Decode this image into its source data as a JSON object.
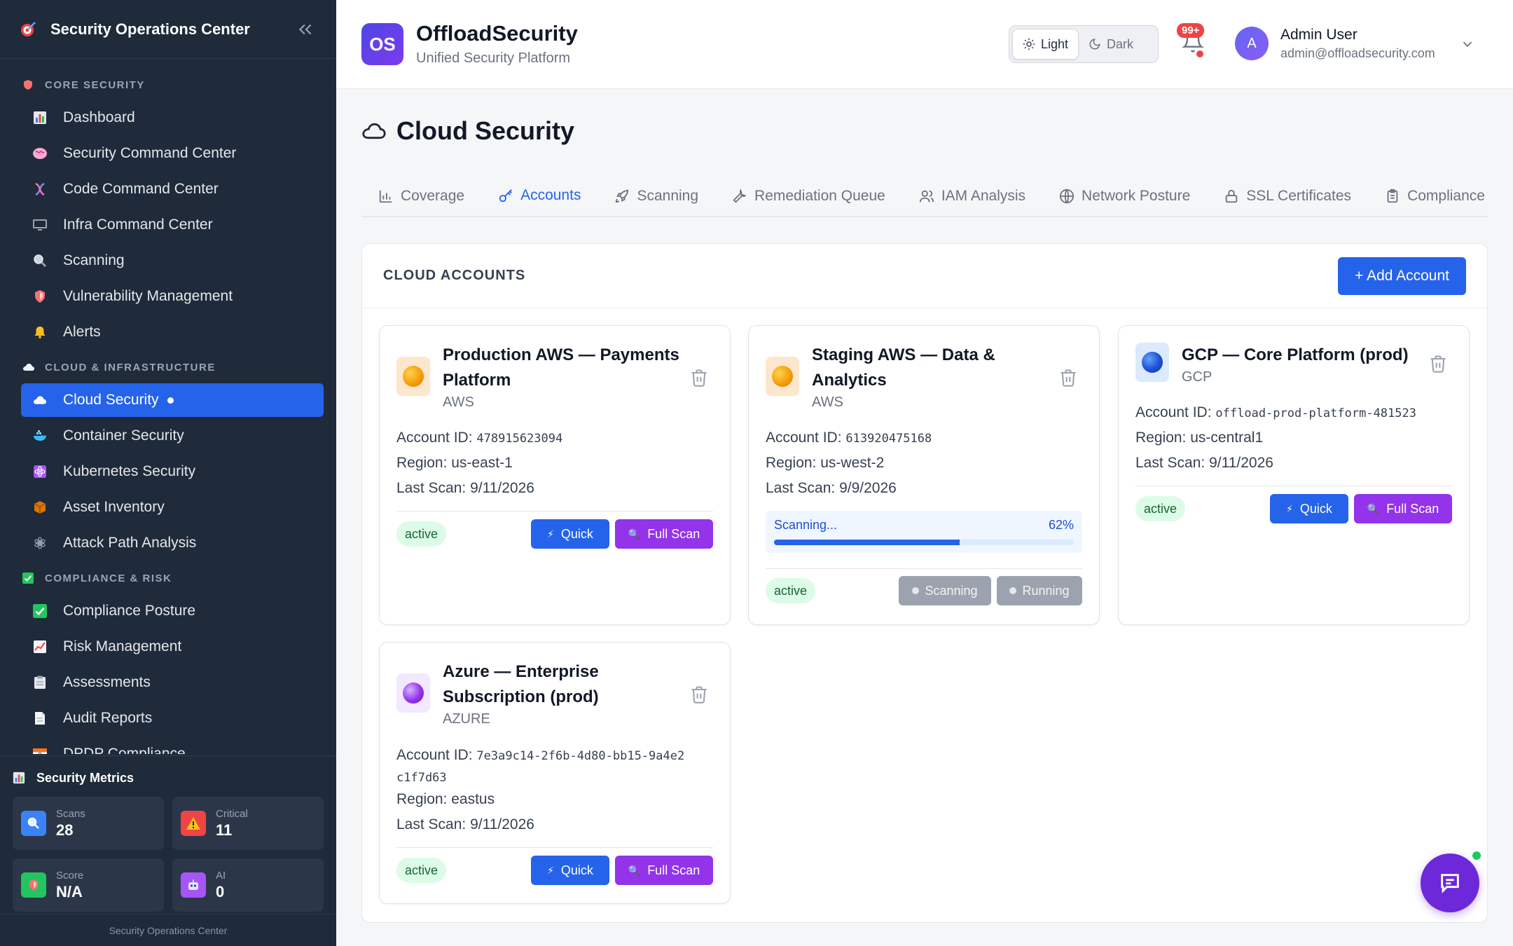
{
  "sidebar": {
    "title": "Security Operations Center",
    "sections": [
      {
        "label": "CORE SECURITY",
        "items": [
          {
            "label": "Dashboard",
            "icon": "bar-chart-icon",
            "color": "#3b82f6"
          },
          {
            "label": "Security Command Center",
            "icon": "brain-icon",
            "color": "#f472b6"
          },
          {
            "label": "Code Command Center",
            "icon": "dna-icon",
            "color": "#818cf8"
          },
          {
            "label": "Infra Command Center",
            "icon": "monitor-icon",
            "color": "#9ca3af"
          },
          {
            "label": "Scanning",
            "icon": "magnifier-icon",
            "color": "#cbd5e1"
          },
          {
            "label": "Vulnerability Management",
            "icon": "shield-icon",
            "color": "#f87171"
          },
          {
            "label": "Alerts",
            "icon": "bell-icon",
            "color": "#fbbf24"
          }
        ]
      },
      {
        "label": "CLOUD & INFRASTRUCTURE",
        "items": [
          {
            "label": "Cloud Security",
            "icon": "cloud-icon",
            "color": "#ffffff",
            "active": true
          },
          {
            "label": "Container Security",
            "icon": "whale-icon",
            "color": "#38bdf8"
          },
          {
            "label": "Kubernetes Security",
            "icon": "atom-icon",
            "color": "#c084fc"
          },
          {
            "label": "Asset Inventory",
            "icon": "package-icon",
            "color": "#d97706"
          },
          {
            "label": "Attack Path Analysis",
            "icon": "network-icon",
            "color": "#94a3b8"
          }
        ]
      },
      {
        "label": "COMPLIANCE & RISK",
        "items": [
          {
            "label": "Compliance Posture",
            "icon": "check-box-icon",
            "color": "#22c55e"
          },
          {
            "label": "Risk Management",
            "icon": "trend-chart-icon",
            "color": "#f1f5f9"
          },
          {
            "label": "Assessments",
            "icon": "clipboard-icon",
            "color": "#e5e7eb"
          },
          {
            "label": "Audit Reports",
            "icon": "document-icon",
            "color": "#e5e7eb"
          },
          {
            "label": "DPDP Compliance",
            "icon": "flag-icon",
            "color": "#f97316"
          }
        ]
      }
    ],
    "metrics": {
      "title": "Security Metrics",
      "cards": [
        {
          "label": "Scans",
          "value": "28",
          "icon": "magnifier-icon",
          "color": "#3b82f6"
        },
        {
          "label": "Critical",
          "value": "11",
          "icon": "warning-icon",
          "color": "#ef4444"
        },
        {
          "label": "Score",
          "value": "N/A",
          "icon": "shield-icon",
          "color": "#22c55e"
        },
        {
          "label": "AI",
          "value": "0",
          "icon": "robot-icon",
          "color": "#a855f7"
        }
      ]
    },
    "footer": "Security Operations Center"
  },
  "header": {
    "badge": "OS",
    "brand": "OffloadSecurity",
    "subtitle": "Unified Security Platform",
    "theme": {
      "light": "Light",
      "dark": "Dark",
      "selected": "Light"
    },
    "notifications": "99+",
    "user": {
      "initial": "A",
      "name": "Admin User",
      "email": "admin@offloadsecurity.com"
    }
  },
  "page": {
    "title": "Cloud Security",
    "tabs": [
      {
        "label": "Coverage",
        "icon": "bar-chart-icon"
      },
      {
        "label": "Accounts",
        "icon": "key-icon",
        "active": true
      },
      {
        "label": "Scanning",
        "icon": "rocket-icon"
      },
      {
        "label": "Remediation Queue",
        "icon": "wrench-icon"
      },
      {
        "label": "IAM Analysis",
        "icon": "users-icon"
      },
      {
        "label": "Network Posture",
        "icon": "globe-icon"
      },
      {
        "label": "SSL Certificates",
        "icon": "lock-icon"
      },
      {
        "label": "Compliance",
        "icon": "clipboard-icon"
      }
    ]
  },
  "accounts": {
    "title": "CLOUD ACCOUNTS",
    "add_label": "+ Add Account",
    "id_label": "Account ID:",
    "region_label": "Region:",
    "scan_label": "Last Scan:",
    "quick_label": "Quick",
    "full_label": "Full Scan",
    "items": [
      {
        "name": "Production AWS — Payments Platform",
        "provider": "AWS",
        "account_id": "478915623094",
        "region": "us-east-1",
        "last_scan": "9/11/2026",
        "status": "active",
        "color": "#f59e0b"
      },
      {
        "name": "Staging AWS — Data & Analytics",
        "provider": "AWS",
        "account_id": "613920475168",
        "region": "us-west-2",
        "last_scan": "9/9/2026",
        "status": "active",
        "color": "#f59e0b",
        "scanning": {
          "label": "Scanning...",
          "progress_text": "62%",
          "progress": 0.62,
          "btn_scanning": "Scanning",
          "btn_running": "Running"
        }
      },
      {
        "name": "GCP — Core Platform (prod)",
        "provider": "GCP",
        "account_id": "offload-prod-platform-481523",
        "region": "us-central1",
        "last_scan": "9/11/2026",
        "status": "active",
        "color": "#1d4ed8"
      },
      {
        "name": "Azure — Enterprise Subscription (prod)",
        "provider": "AZURE",
        "account_id": "7e3a9c14-2f6b-4d80-bb15-9a4e2c1f7d63",
        "region": "eastus",
        "last_scan": "9/11/2026",
        "status": "active",
        "color": "#9333ea"
      }
    ]
  }
}
